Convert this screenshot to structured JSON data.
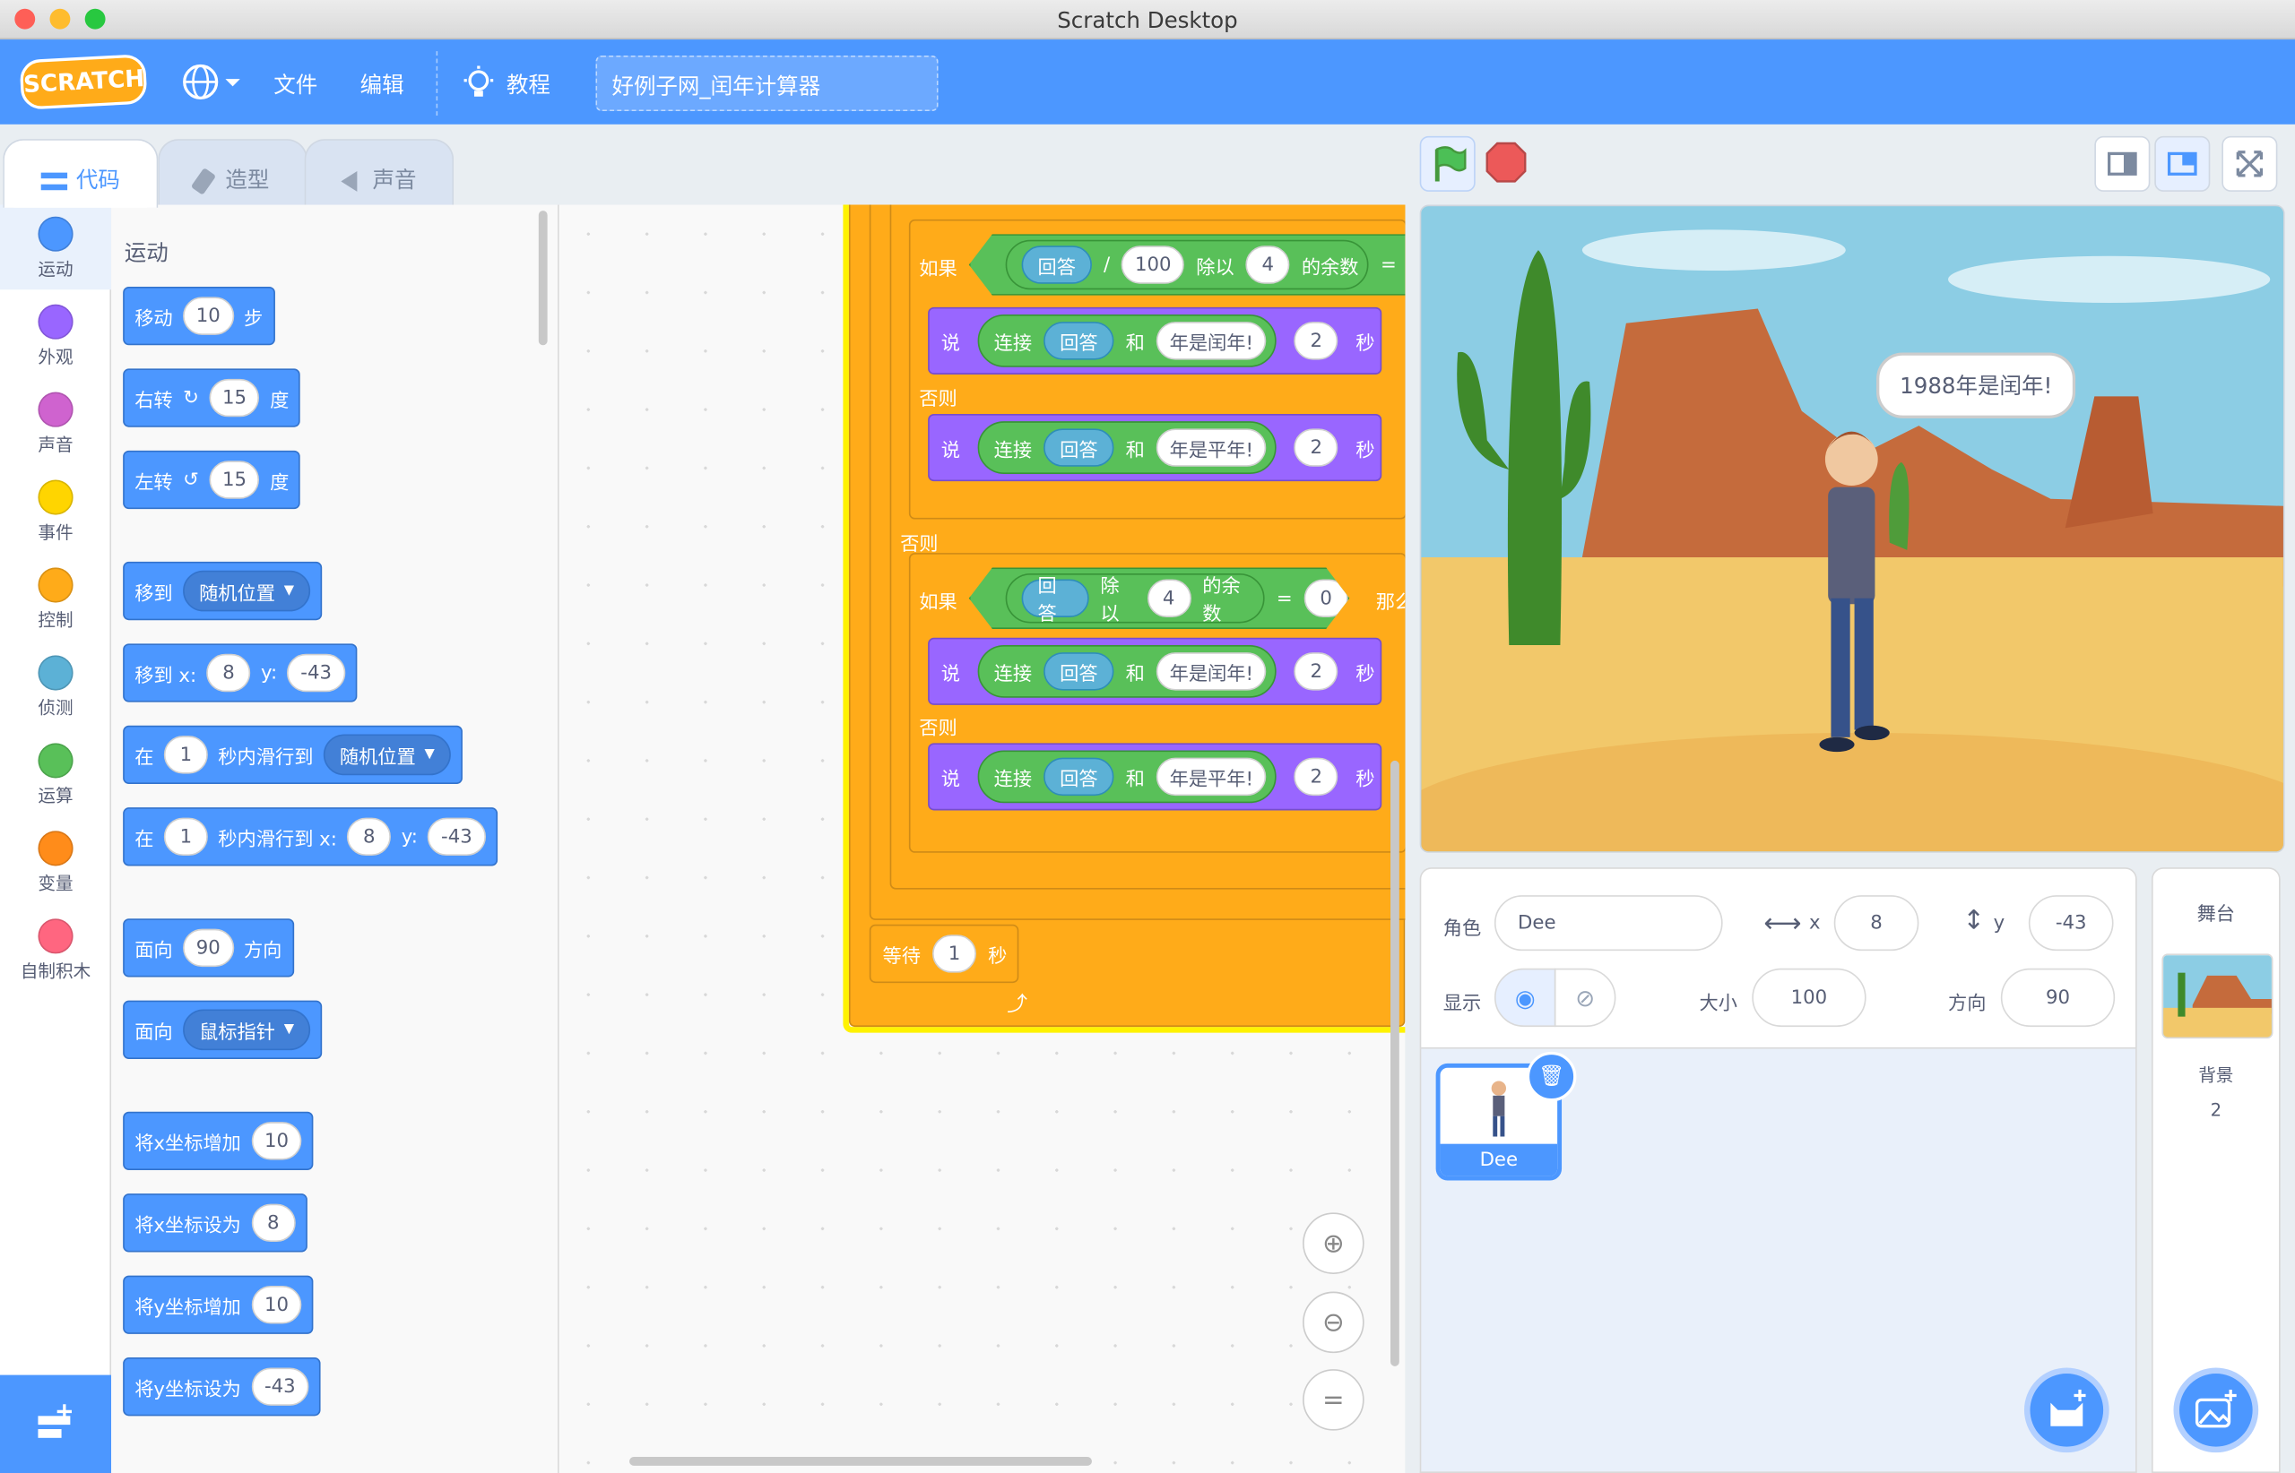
{
  "window": {
    "title": "Scratch Desktop"
  },
  "menubar": {
    "logo": "SCRATCH",
    "file": "文件",
    "edit": "编辑",
    "tutorials": "教程",
    "project_title": "好例子网_闰年计算器"
  },
  "tabs": {
    "code": "代码",
    "costumes": "造型",
    "sounds": "声音"
  },
  "categories": [
    {
      "label": "运动",
      "color": "#4c97ff"
    },
    {
      "label": "外观",
      "color": "#9966ff"
    },
    {
      "label": "声音",
      "color": "#cf63cf"
    },
    {
      "label": "事件",
      "color": "#ffd500"
    },
    {
      "label": "控制",
      "color": "#ffab19"
    },
    {
      "label": "侦测",
      "color": "#5cb1d6"
    },
    {
      "label": "运算",
      "color": "#59c059"
    },
    {
      "label": "变量",
      "color": "#ff8c1a"
    },
    {
      "label": "自制积木",
      "color": "#ff6680"
    }
  ],
  "palette": {
    "heading": "运动",
    "move": {
      "a": "移动",
      "v": "10",
      "b": "步"
    },
    "turn_right": {
      "a": "右转",
      "v": "15",
      "b": "度"
    },
    "turn_left": {
      "a": "左转",
      "v": "15",
      "b": "度"
    },
    "goto": {
      "a": "移到",
      "dd": "随机位置"
    },
    "goto_xy": {
      "a": "移到 x:",
      "x": "8",
      "yl": "y:",
      "y": "-43"
    },
    "glide": {
      "a": "在",
      "v": "1",
      "b": "秒内滑行到",
      "dd": "随机位置"
    },
    "glide_xy": {
      "a": "在",
      "v": "1",
      "b": "秒内滑行到 x:",
      "x": "8",
      "yl": "y:",
      "y": "-43"
    },
    "point_dir": {
      "a": "面向",
      "v": "90",
      "b": "方向"
    },
    "point_towards": {
      "a": "面向",
      "dd": "鼠标指针"
    },
    "change_x": {
      "a": "将x坐标增加",
      "v": "10"
    },
    "set_x": {
      "a": "将x坐标设为",
      "v": "8"
    },
    "change_y": {
      "a": "将y坐标增加",
      "v": "10"
    },
    "set_y": {
      "a": "将y坐标设为",
      "v": "-43"
    }
  },
  "script": {
    "if1": {
      "if": "如果",
      "answer": "回答",
      "div": "/",
      "hundred": "100",
      "mod": "除以",
      "four": "4",
      "rem": "的余数",
      "eq": "="
    },
    "say1": {
      "say": "说",
      "join": "连接",
      "answer": "回答",
      "and": "和",
      "text": "年是闰年!",
      "secs": "2",
      "unit": "秒"
    },
    "else1": "否则",
    "say2": {
      "say": "说",
      "join": "连接",
      "answer": "回答",
      "and": "和",
      "text": "年是平年!",
      "secs": "2",
      "unit": "秒"
    },
    "else2": "否则",
    "if2": {
      "if": "如果",
      "answer": "回答",
      "mod": "除以",
      "four": "4",
      "rem": "的余数",
      "eq": "=",
      "zero": "0",
      "then": "那么"
    },
    "say3": {
      "say": "说",
      "join": "连接",
      "answer": "回答",
      "and": "和",
      "text": "年是闰年!",
      "secs": "2",
      "unit": "秒"
    },
    "else3": "否则",
    "say4": {
      "say": "说",
      "join": "连接",
      "answer": "回答",
      "and": "和",
      "text": "年是平年!",
      "secs": "2",
      "unit": "秒"
    },
    "wait": {
      "a": "等待",
      "v": "1",
      "b": "秒"
    }
  },
  "stage": {
    "speech": "1988年是闰年!"
  },
  "sprite_info": {
    "sprite_label": "角色",
    "sprite_name": "Dee",
    "x_label": "x",
    "x": "8",
    "y_label": "y",
    "y": "-43",
    "show_label": "显示",
    "size_label": "大小",
    "size": "100",
    "direction_label": "方向",
    "direction": "90"
  },
  "sprite_list": [
    {
      "name": "Dee"
    }
  ],
  "stage_panel": {
    "title": "舞台",
    "backdrops_label": "背景",
    "backdrops_count": "2"
  }
}
